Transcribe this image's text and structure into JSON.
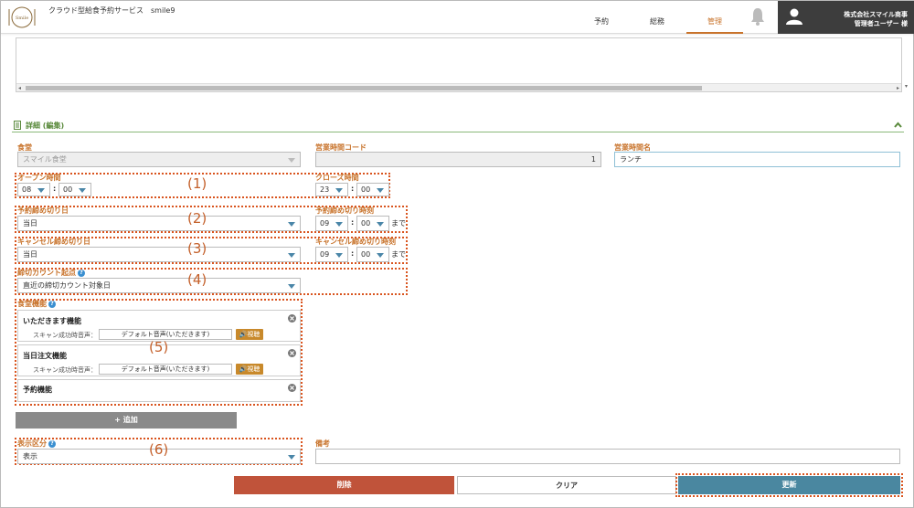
{
  "header": {
    "app_title": "クラウド型給食予約サービス　smile9",
    "tabs": [
      "予約",
      "総務",
      "管理"
    ],
    "active_tab": "管理",
    "company": "株式会社スマイル商事",
    "user": "管理者ユーザー 様",
    "logo_text": "Smile"
  },
  "section": {
    "title": "詳細 (編集)"
  },
  "form": {
    "cafeteria_label": "食堂",
    "cafeteria_value": "スマイル食堂",
    "hours_code_label": "営業時間コード",
    "hours_code_value": "1",
    "hours_name_label": "営業時間名",
    "hours_name_value": "ランチ",
    "open_label": "オープン時間",
    "open_hour": "08",
    "open_min": "00",
    "close_label": "クローズ時間",
    "close_hour": "23",
    "close_min": "00",
    "res_deadline_day_label": "予約締め切り日",
    "res_deadline_day_value": "当日",
    "res_deadline_time_label": "予約締め切り時刻",
    "res_deadline_hour": "09",
    "res_deadline_min": "00",
    "cancel_deadline_day_label": "キャンセル締め切り日",
    "cancel_deadline_day_value": "当日",
    "cancel_deadline_time_label": "キャンセル締め切り時刻",
    "cancel_deadline_hour": "09",
    "cancel_deadline_min": "00",
    "until": "まで",
    "count_start_label": "締切カウント起点",
    "count_start_value": "直近の締切カウント対象日",
    "features_label": "食堂機能",
    "display_label": "表示区分",
    "display_value": "表示",
    "notes_label": "備考",
    "colon": ":"
  },
  "features": [
    {
      "title": "いただきます機能",
      "sound_label": "スキャン成功時音声：",
      "sound_value": "デフォルト音声(いただきます)",
      "listen": "視聴"
    },
    {
      "title": "当日注文機能",
      "sound_label": "スキャン成功時音声：",
      "sound_value": "デフォルト音声(いただきます)",
      "listen": "視聴"
    },
    {
      "title": "予約機能"
    }
  ],
  "buttons": {
    "add": "+ 追加",
    "delete": "削除",
    "clear": "クリア",
    "update": "更新"
  },
  "annotations": [
    "(1)",
    "(2)",
    "(3)",
    "(4)",
    "(5)",
    "(6)"
  ],
  "help_glyph": "?",
  "colors": {
    "accent": "#c8732b",
    "section_green": "#5a8a3c",
    "delete": "#c0533a",
    "update": "#4a87a0",
    "annotation": "#d9541e"
  }
}
